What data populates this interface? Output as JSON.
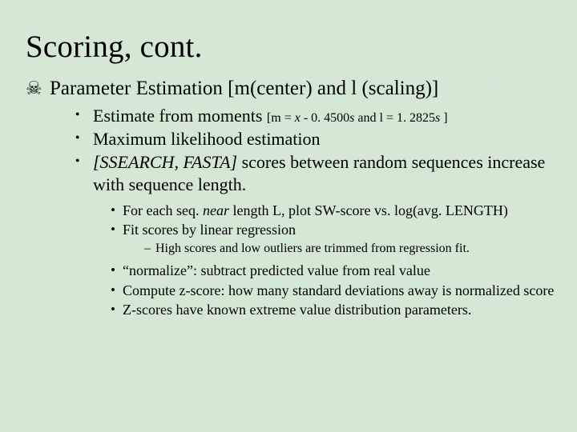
{
  "title": "Scoring, cont.",
  "heading": {
    "icon": "☠",
    "pre": "Parameter Estimation [",
    "mu": "m",
    "mid1": "(center) and ",
    "lambda": "l",
    "post": " (scaling)]"
  },
  "l1": {
    "a": {
      "pre": "Estimate from moments ",
      "form_open": "[",
      "mu": "m",
      "eq1": " = ",
      "x": "x",
      "mid": " - 0. 4500",
      "s1": "s",
      "and": " and ",
      "lambda": "l",
      "eq2": " = 1. 2825",
      "s2": "s",
      "close": " ]"
    },
    "b": "Maximum likelihood estimation",
    "c": {
      "em": "[SSEARCH, FASTA]",
      "rest": " scores between random sequences increase with sequence length."
    }
  },
  "l2": {
    "a": {
      "pre": "For each seq. ",
      "em": "near",
      "post": " length L, plot SW-score vs. log(avg. LENGTH)"
    },
    "b": "Fit scores by linear regression",
    "c": "“normalize”: subtract predicted value from real value",
    "d": "Compute z-score: how many standard deviations away is normalized score",
    "e": "Z-scores have known extreme value distribution parameters."
  },
  "l3": {
    "a": "High scores and low outliers are trimmed from regression fit."
  }
}
